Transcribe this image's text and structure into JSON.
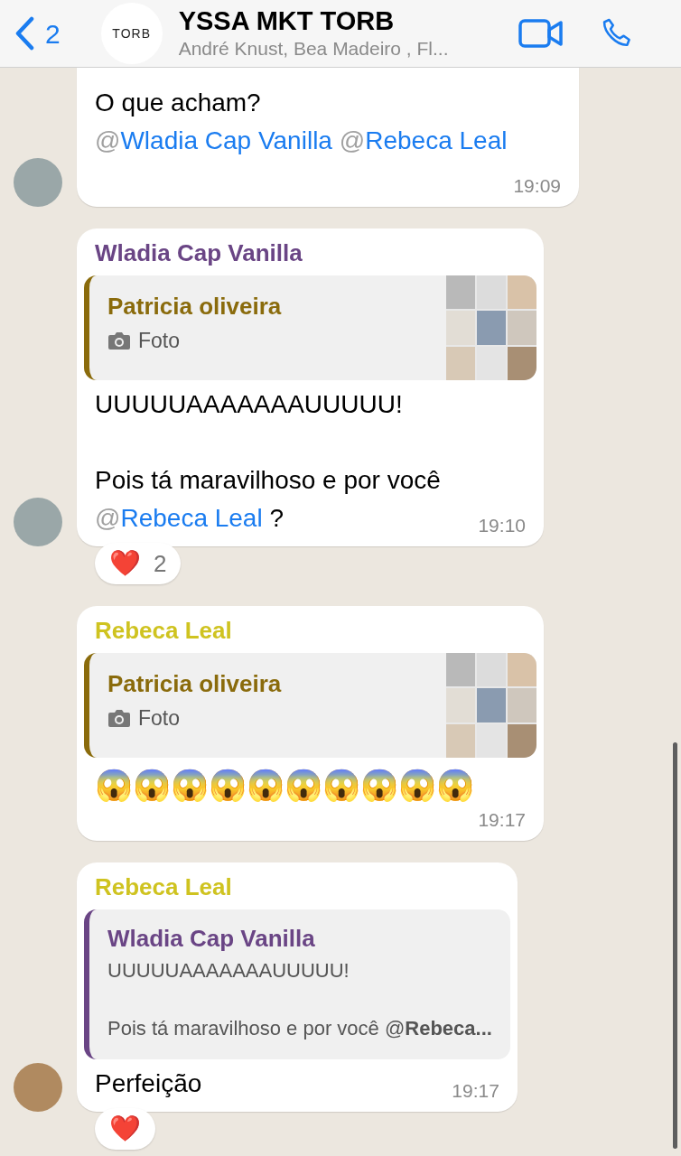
{
  "header": {
    "back_count": "2",
    "avatar_text": "TORB",
    "title": "YSSA MKT TORB",
    "subtitle": "André Knust, Bea Madeiro , Fl..."
  },
  "messages": [
    {
      "avatar": true,
      "cut_top": true,
      "body": [
        {
          "kind": "text",
          "text": "O que acham? "
        },
        {
          "kind": "mention",
          "at": "@",
          "name": "Wladia Cap Vanilla"
        },
        {
          "kind": "mention",
          "at": "@",
          "name": "Rebeca Leal"
        }
      ],
      "time": "19:09"
    },
    {
      "avatar": true,
      "sender": {
        "name": "Wladia Cap Vanilla",
        "color": "#6a4585"
      },
      "quote": {
        "kind": "photo",
        "name": "Patricia oliveira",
        "color": "#8a6b0c",
        "label": "Foto"
      },
      "body": [
        {
          "kind": "text",
          "text": "UUUUUAAAAAAAUUUUU!\n\nPois tá maravilhoso e por você\n"
        },
        {
          "kind": "mention",
          "at": "@",
          "name": "Rebeca Leal"
        },
        {
          "kind": "text",
          "text": " ?"
        }
      ],
      "time": "19:10",
      "reaction": {
        "emoji": "❤️",
        "count": "2"
      }
    },
    {
      "avatar": false,
      "sender": {
        "name": "Rebeca Leal",
        "color": "#cfc320"
      },
      "quote": {
        "kind": "photo",
        "name": "Patricia oliveira",
        "color": "#8a6b0c",
        "label": "Foto"
      },
      "body": [
        {
          "kind": "emoji",
          "text": "😱😱😱😱😱😱😱😱😱😱"
        }
      ],
      "time": "19:17"
    },
    {
      "avatar": true,
      "sender": {
        "name": "Rebeca Leal",
        "color": "#cfc320"
      },
      "quote": {
        "kind": "text",
        "name": "Wladia Cap Vanilla",
        "color": "#6a4585",
        "lines": [
          "UUUUUAAAAAAAUUUUU!",
          "Pois tá maravilhoso e por você @**Rebeca...**"
        ]
      },
      "body": [
        {
          "kind": "text",
          "text": "Perfeição"
        }
      ],
      "time": "19:17",
      "reaction": {
        "emoji": "❤️"
      }
    }
  ]
}
